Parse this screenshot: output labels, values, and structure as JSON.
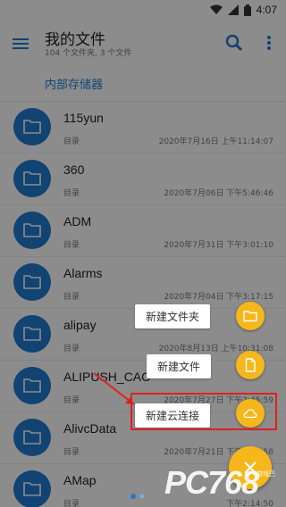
{
  "status_bar": {
    "time": "4:07",
    "icons": [
      "wifi-icon",
      "signal-icon",
      "battery-icon"
    ]
  },
  "header": {
    "title": "我的文件",
    "subtitle": "104 个文件夹, 3 个文件",
    "icons": [
      "menu-icon",
      "search-icon",
      "more-vert-icon"
    ]
  },
  "breadcrumb": "内部存储器",
  "files": [
    {
      "name": "115yun",
      "type": "目录",
      "date": "2020年7月16日 上午11:14:07"
    },
    {
      "name": "360",
      "type": "目录",
      "date": "2020年7月06日 下午5:46:46"
    },
    {
      "name": "ADM",
      "type": "目录",
      "date": "2020年7月31日 下午3:01:10"
    },
    {
      "name": "Alarms",
      "type": "目录",
      "date": "2020年7月04日 下午3:17:15"
    },
    {
      "name": "alipay",
      "type": "目录",
      "date": "2020年8月13日 上午10:31:08"
    },
    {
      "name": "ALIPUSH_CAC",
      "type": "目录",
      "date": "2020年7月27日 下午2:45:59"
    },
    {
      "name": "AlivcData",
      "type": "目录",
      "date": "2020年7月21日 下午2:37:58"
    },
    {
      "name": "AMap",
      "type": "目录",
      "date": "下午2:14:50"
    }
  ],
  "fab_menu": {
    "new_folder": "新建文件夹",
    "new_file": "新建文件",
    "new_cloud": "新建云连接",
    "icons": [
      "folder-icon",
      "file-icon",
      "cloud-icon",
      "close-icon"
    ]
  },
  "watermark": {
    "text": "PC768",
    "sub": "游戏巴"
  },
  "colors": {
    "accent": "#1f7ad2",
    "fab": "#f5b71b",
    "highlight": "#e02020"
  }
}
